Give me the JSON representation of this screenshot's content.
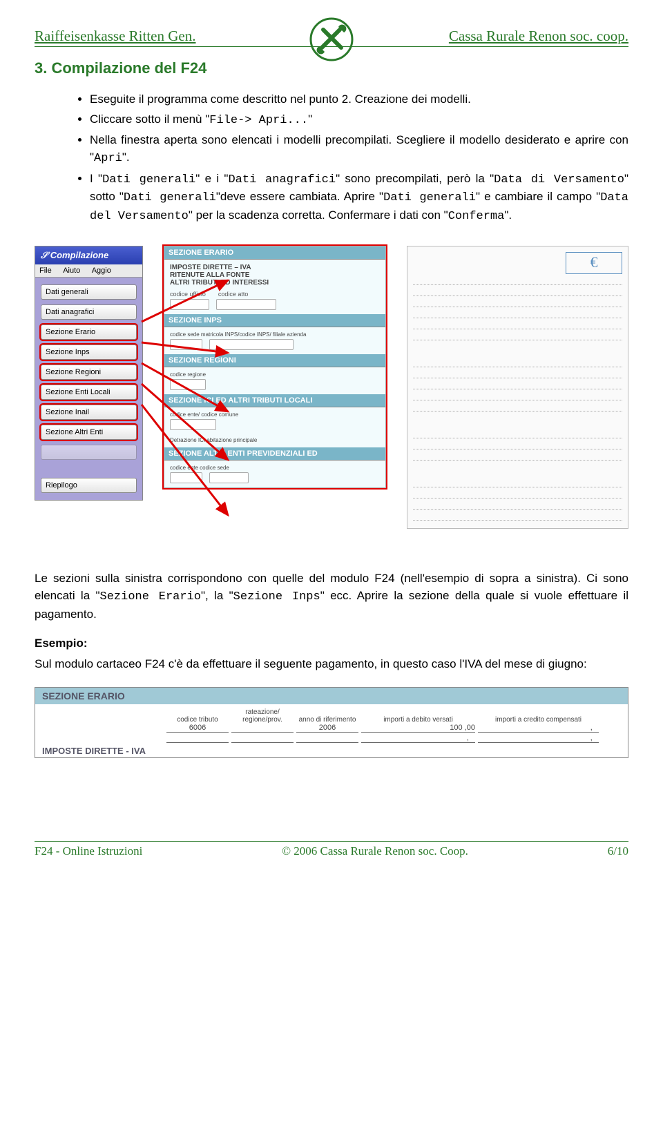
{
  "header": {
    "left": "Raiffeisenkasse Ritten Gen.",
    "right": "Cassa Rurale Renon soc. coop."
  },
  "section_title": "3. Compilazione del F24",
  "bullets": {
    "b1": "Eseguite il programma come descritto nel punto 2. Creazione dei modelli.",
    "b2_a": "Cliccare sotto il menù \"",
    "b2_code": "File-> Apri...",
    "b2_b": "\"",
    "b3_a": "Nella finestra aperta sono elencati i modelli precompilati. Scegliere il modello desiderato e aprire con \"",
    "b3_code": "Apri",
    "b3_b": "\".",
    "b4_a": "   I \"",
    "b4_code1": "Dati generali",
    "b4_b": "\" e i \"",
    "b4_code2": "Dati anagrafici",
    "b4_c": "\" sono precompilati, però la \"",
    "b4_code3": "Data di Versamento",
    "b4_d": "\" sotto \"",
    "b4_code4": "Dati generali",
    "b4_e": "\"deve essere cambiata. Aprire \"",
    "b4_code5": "Dati generali",
    "b4_f": "\" e cambiare il campo \"",
    "b4_code6": "Data del Versamento",
    "b4_g": "\" per la scadenza corretta. Confermare i dati con \"",
    "b4_code7": "Conferma",
    "b4_h": "\"."
  },
  "app": {
    "title": "Compilazione",
    "menu_file": "File",
    "menu_aiuto": "Aiuto",
    "menu_aggio": "Aggio",
    "btn_dati_gen": "Dati generali",
    "btn_dati_ana": "Dati anagrafici",
    "btn_sez_erario": "Sezione Erario",
    "btn_sez_inps": "Sezione Inps",
    "btn_sez_regioni": "Sezione Regioni",
    "btn_sez_enti": "Sezione Enti Locali",
    "btn_sez_inail": "Sezione Inail",
    "btn_sez_altri": "Sezione Altri Enti",
    "btn_riepilogo": "Riepilogo"
  },
  "form": {
    "sec_erario": "SEZIONE ERARIO",
    "imposte": "IMPOSTE DIRETTE – IVA",
    "ritenute": "RITENUTE ALLA FONTE",
    "altri": "ALTRI TRIBUTI ED INTERESSI",
    "codice_ufficio": "codice ufficio",
    "codice_atto": "codice atto",
    "sec_inps": "SEZIONE INPS",
    "inps_labels": "codice sede   matricola INPS/codice INPS/ filiale azienda",
    "sec_regioni": "SEZIONE REGIONI",
    "reg_label": "codice regione",
    "sec_ici": "SEZIONE ICI ED ALTRI TRIBUTI LOCALI",
    "ici_labels": "codice ente/ codice comune",
    "sec_altri": "SEZIONE ALTRI ENTI PREVIDENZIALI ED",
    "altri_labels": "codice ente   codice sede",
    "euro": "€"
  },
  "para1_a": "Le sezioni sulla sinistra corrispondono con quelle del modulo F24 (nell'esempio di sopra  a sinistra). Ci sono elencati la \"",
  "para1_code1": "Sezione Erario",
  "para1_b": "\", la \"",
  "para1_code2": "Sezione Inps",
  "para1_c": "\" ecc. Aprire la sezione della quale si vuole effettuare il pagamento.",
  "esempio": "Esempio:",
  "para2": "Sul modulo cartaceo F24 c'è da effettuare il seguente pagamento, in questo caso l'IVA del mese di giugno:",
  "erario": {
    "head": "SEZIONE ERARIO",
    "col_codice": "codice tributo",
    "col_rateaz": "rateazione/ regione/prov.",
    "col_anno": "anno di riferimento",
    "col_debito": "importi a debito versati",
    "col_credito": "importi a credito compensati",
    "val_codice": "6006",
    "val_anno": "2006",
    "val_imp": "100",
    "val_dec": "00",
    "sub": "IMPOSTE DIRETTE - IVA"
  },
  "footer": {
    "left": "F24 - Online Istruzioni",
    "center": "© 2006 Cassa Rurale Renon soc. Coop.",
    "right": "6/10"
  }
}
